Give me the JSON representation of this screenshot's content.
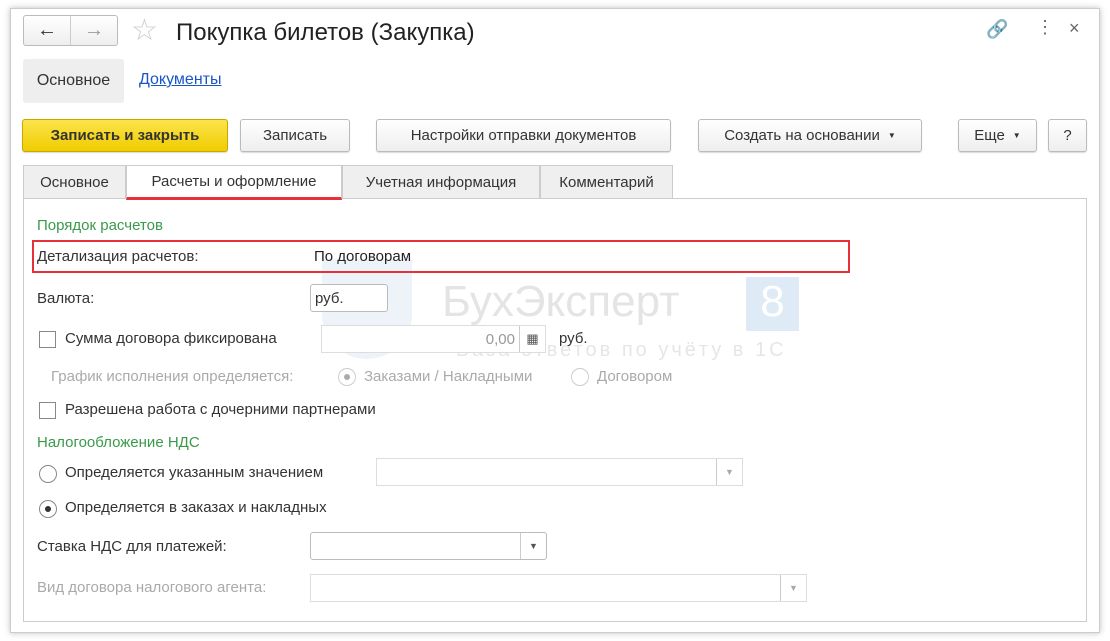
{
  "window": {
    "title": "Покупка билетов (Закупка)"
  },
  "nav_tabs": [
    "Основное",
    "Документы"
  ],
  "toolbar": {
    "save_close": "Записать и закрыть",
    "save": "Записать",
    "send_settings": "Настройки отправки документов",
    "create_based": "Создать на основании",
    "more": "Еще",
    "help": "?"
  },
  "tabs": [
    "Основное",
    "Расчеты и оформление",
    "Учетная информация",
    "Комментарий"
  ],
  "form": {
    "section1": "Порядок расчетов",
    "detail_label": "Детализация расчетов:",
    "detail_value": "По договорам",
    "currency_label": "Валюта:",
    "currency_value": "руб.",
    "fixed_sum_label": "Сумма договора фиксирована",
    "fixed_sum_value": "0,00",
    "fixed_sum_unit": "руб.",
    "schedule_label": "График исполнения определяется:",
    "schedule_opt1": "Заказами / Накладными",
    "schedule_opt2": "Договором",
    "subpartners_label": "Разрешена работа с дочерними партнерами",
    "section2": "Налогообложение НДС",
    "vat_opt1": "Определяется указанным значением",
    "vat_opt2": "Определяется в заказах и накладных",
    "vat_rate_label": "Ставка НДС для платежей:",
    "agent_label": "Вид договора налогового агента:"
  },
  "watermark": {
    "brand": "БухЭксперт",
    "badge": "8",
    "tagline": "База ответов по учёту в 1С"
  },
  "colors": {
    "accent_red": "#e8303a",
    "yellow": "#f5d60a",
    "green": "#3a9a4a"
  }
}
